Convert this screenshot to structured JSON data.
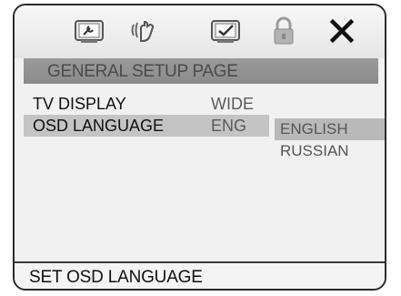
{
  "tabs": [
    {
      "icon": "general-setup-icon"
    },
    {
      "icon": "audio-setup-icon"
    },
    {
      "icon": "preference-icon"
    },
    {
      "icon": "lock-icon"
    },
    {
      "icon": "close-icon"
    }
  ],
  "page_title": "GENERAL SETUP PAGE",
  "settings": [
    {
      "label": "TV DISPLAY",
      "value": "WIDE"
    },
    {
      "label": "OSD LANGUAGE",
      "value": "ENG"
    }
  ],
  "options": [
    "ENGLISH",
    "RUSSIAN"
  ],
  "selected_option": "ENGLISH",
  "status": "SET OSD LANGUAGE",
  "colors": {
    "highlight": "#c4c4c4",
    "title_bar": "#909090"
  }
}
